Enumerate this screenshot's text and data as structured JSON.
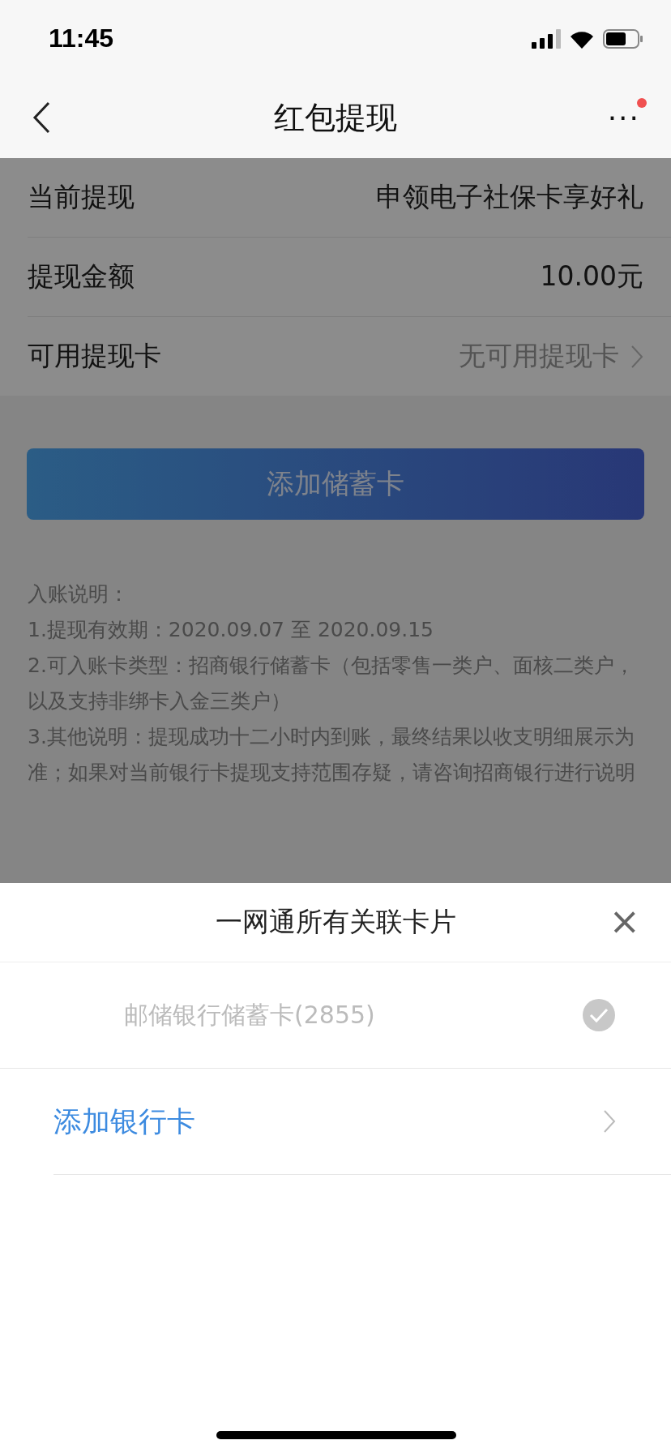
{
  "status_bar": {
    "time": "11:45"
  },
  "nav": {
    "title": "红包提现",
    "more": "···",
    "notification": true
  },
  "rows": [
    {
      "label": "当前提现",
      "value": "申领电子社保卡享好礼",
      "kind": "static"
    },
    {
      "label": "提现金额",
      "value": "10.00元",
      "kind": "static"
    },
    {
      "label": "可用提现卡",
      "value": "无可用提现卡",
      "kind": "select"
    }
  ],
  "button": {
    "label": "添加储蓄卡"
  },
  "notes": {
    "heading": "入账说明：",
    "items": [
      "1.提现有效期：2020.09.07 至 2020.09.15",
      "2.可入账卡类型：招商银行储蓄卡（包括零售一类户、面核二类户，以及支持非绑卡入金三类户）",
      "3.其他说明：提现成功十二小时内到账，最终结果以收支明细展示为准；如果对当前银行卡提现支持范围存疑，请咨询招商银行进行说明"
    ]
  },
  "sheet": {
    "title": "一网通所有关联卡片",
    "close": "×",
    "items": [
      {
        "kind": "card",
        "label": "邮储银行储蓄卡(2855)",
        "selected": true
      },
      {
        "kind": "add",
        "label": "添加银行卡"
      }
    ]
  }
}
